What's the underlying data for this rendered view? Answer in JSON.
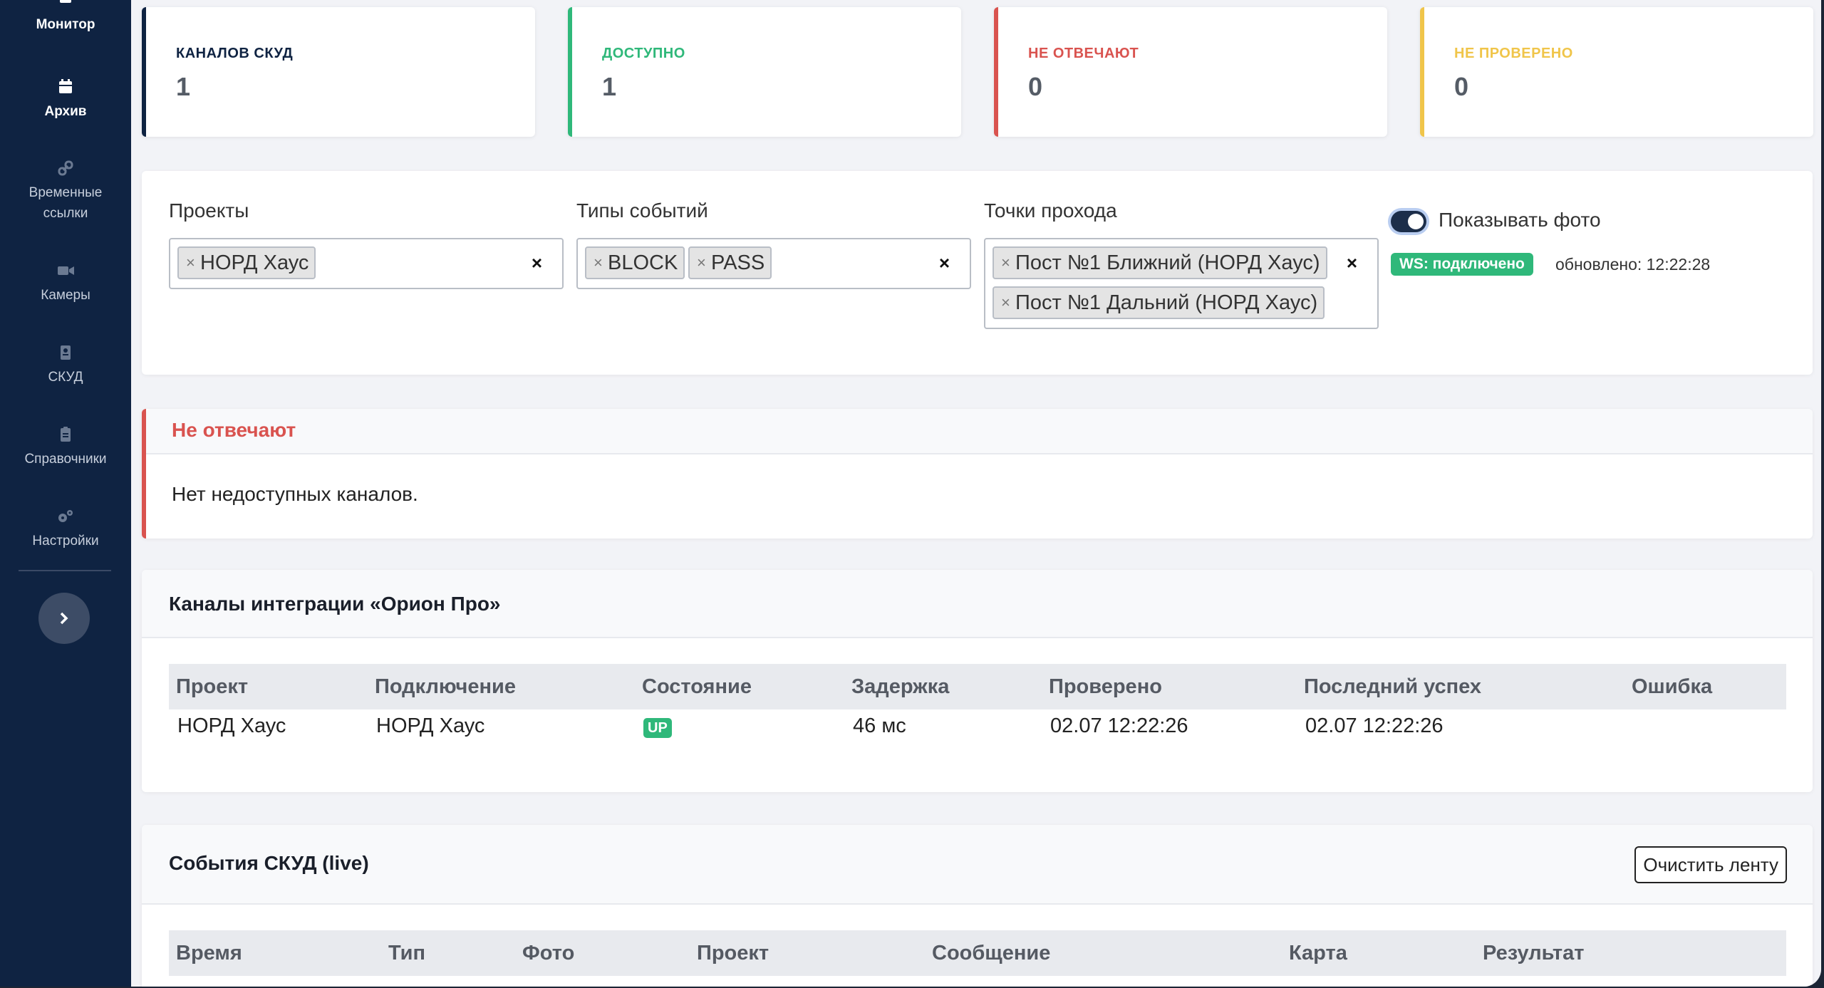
{
  "sidebar": {
    "items": [
      {
        "label": "Монитор",
        "icon": "monitor-icon"
      },
      {
        "label": "Архив",
        "icon": "calendar-icon"
      },
      {
        "label": "Временные\nссылки",
        "label1": "Временные",
        "label2": "ссылки",
        "icon": "link-icon"
      },
      {
        "label": "Камеры",
        "icon": "video-camera-icon"
      },
      {
        "label": "СКУД",
        "icon": "badge-icon"
      },
      {
        "label": "Справочники",
        "icon": "clipboard-icon"
      },
      {
        "label": "Настройки",
        "icon": "gears-icon"
      }
    ]
  },
  "stats": [
    {
      "label": "КАНАЛОВ СКУД",
      "value": "1",
      "color": "#0f2342"
    },
    {
      "label": "ДОСТУПНО",
      "value": "1",
      "color": "#2fb87a"
    },
    {
      "label": "НЕ ОТВЕЧАЮТ",
      "value": "0",
      "color": "#d9534f"
    },
    {
      "label": "НЕ ПРОВЕРЕНО",
      "value": "0",
      "color": "#f0c54a"
    }
  ],
  "filters": {
    "projects_label": "Проекты",
    "projects_tags": [
      "НОРД Хаус"
    ],
    "types_label": "Типы событий",
    "types_tags": [
      "BLOCK",
      "PASS"
    ],
    "points_label": "Точки прохода",
    "points_tags": [
      "Пост №1 Ближний (НОРД Хаус)",
      "Пост №1 Дальний (НОРД Хаус)"
    ],
    "clear": "×",
    "tag_x": "×",
    "show_photo_label": "Показывать фото",
    "show_photo": true,
    "ws_status": "WS: подключено",
    "updated": "обновлено: 12:22:28"
  },
  "not_responding": {
    "title": "Не отвечают",
    "message": "Нет недоступных каналов."
  },
  "channels": {
    "title": "Каналы интеграции «Орион Про»",
    "columns": [
      "Проект",
      "Подключение",
      "Состояние",
      "Задержка",
      "Проверено",
      "Последний успех",
      "Ошибка"
    ],
    "rows": [
      {
        "project": "НОРД Хаус",
        "connection": "НОРД Хаус",
        "state": "UP",
        "latency": "46 мс",
        "checked": "02.07 12:22:26",
        "last_success": "02.07 12:22:26",
        "error": ""
      }
    ]
  },
  "events": {
    "title": "События СКУД (live)",
    "clear_button": "Очистить ленту",
    "columns": [
      "Время",
      "Тип",
      "Фото",
      "Проект",
      "Сообщение",
      "Карта",
      "Результат"
    ]
  },
  "colors": {
    "sidebar_bg": "#0f2342",
    "accent_green": "#2fb87a",
    "accent_red": "#d9534f",
    "accent_yellow": "#f0c54a"
  }
}
